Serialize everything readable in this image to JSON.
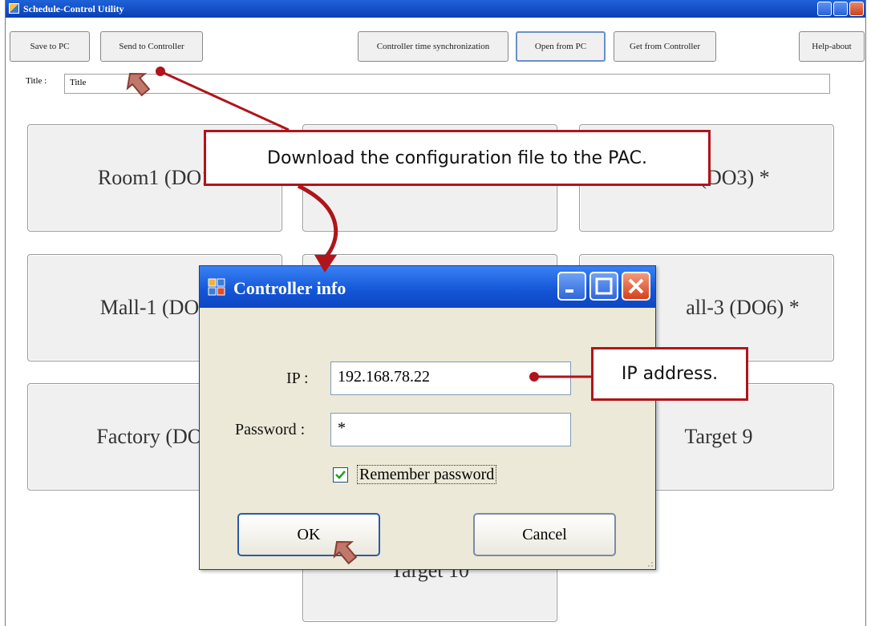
{
  "window": {
    "title": "Schedule-Control Utility"
  },
  "toolbar": {
    "save_to_pc": "Save to PC",
    "send_to_controller": "Send to Controller",
    "time_sync": "Controller time synchronization",
    "open_from_pc": "Open from PC",
    "get_from_controller": "Get from Controller",
    "help_about": "Help-about"
  },
  "title_field": {
    "label": "Title :",
    "value": "Title"
  },
  "tiles": [
    "Room1 (DO1",
    "(DO3) *",
    "Mall-1 (DO4",
    "all-3 (DO6) *",
    "Factory (DO7",
    "Target 9",
    "Target 10"
  ],
  "dialog": {
    "title": "Controller info",
    "ip_label": "IP :",
    "ip_value": "192.168.78.22",
    "password_label": "Password :",
    "password_value": "*",
    "remember_label": "Remember password",
    "remember_checked": true,
    "ok_label": "OK",
    "cancel_label": "Cancel"
  },
  "annotations": {
    "callout_download": "Download the configuration file to the PAC.",
    "callout_ip": "IP address.",
    "accent_color": "#b0141b"
  }
}
